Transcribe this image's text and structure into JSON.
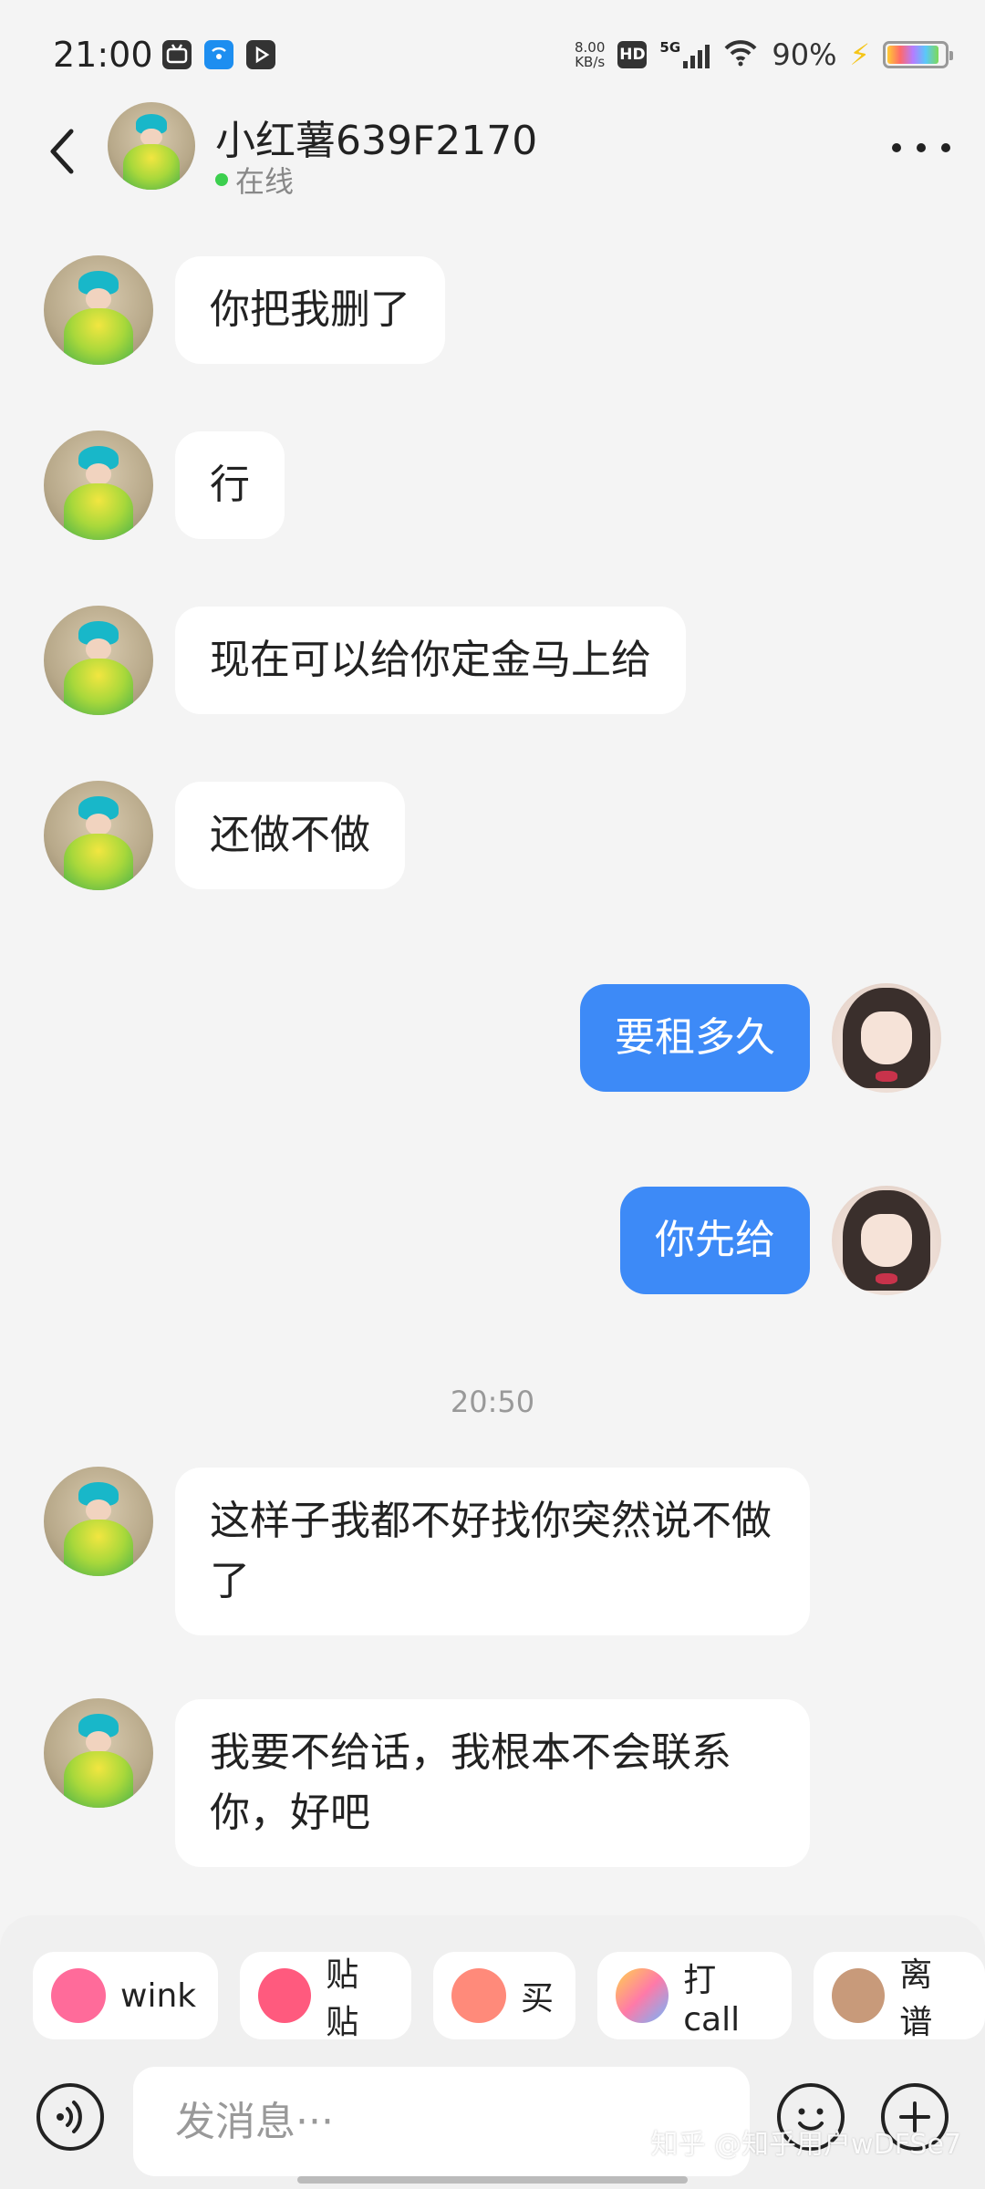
{
  "status_bar": {
    "time": "21:00",
    "net_speed_value": "8.00",
    "net_speed_unit": "KB/s",
    "hd_label": "HD",
    "network": "5G",
    "battery_percent": "90%",
    "battery_level": 0.9,
    "app_icons": [
      "bilibili-icon",
      "wifi-hotspot-icon",
      "media-play-icon"
    ]
  },
  "header": {
    "contact_name": "小红薯639F2170",
    "status": "在线",
    "online_color": "#3ccf4e"
  },
  "messages": [
    {
      "side": "in",
      "text": "你把我删了"
    },
    {
      "side": "in",
      "text": "行"
    },
    {
      "side": "in",
      "text": "现在可以给你定金马上给"
    },
    {
      "side": "in",
      "text": "还做不做"
    },
    {
      "side": "out",
      "text": "要租多久"
    },
    {
      "side": "out",
      "text": "你先给"
    },
    {
      "type": "timestamp",
      "text": "20:50"
    },
    {
      "side": "in",
      "text": "这样子我都不好找你突然说不做了"
    },
    {
      "side": "in",
      "text": "我要不给话，我根本不会联系你，好吧"
    }
  ],
  "quick_stickers": [
    {
      "label": "wink",
      "icon": "wink-bunny-icon"
    },
    {
      "label": "贴贴",
      "icon": "hug-bunny-icon"
    },
    {
      "label": "买",
      "icon": "buy-peach-icon"
    },
    {
      "label": "打call",
      "icon": "glowstick-icon"
    },
    {
      "label": "离谱",
      "icon": "facepalm-icon"
    }
  ],
  "composer": {
    "placeholder": "发消息···"
  },
  "watermark": "知乎 @知乎用户wDFSe7",
  "colors": {
    "outgoing_bubble": "#3d8af7",
    "incoming_bubble": "#ffffff",
    "background": "#f4f4f4"
  }
}
